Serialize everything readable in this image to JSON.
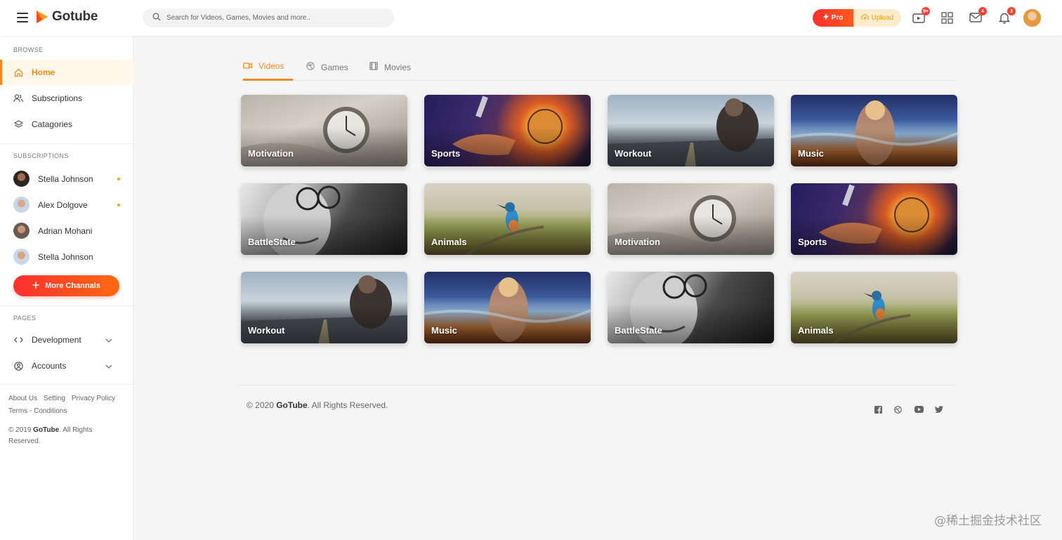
{
  "app": {
    "name": "Gotube",
    "brand_color": "#f3891c",
    "accent_red": "#ff3a2a"
  },
  "header": {
    "search_placeholder": "Search for Videos, Games, Movies and more..",
    "pro_label": "Pro",
    "upload_label": "Upload",
    "icons": [
      {
        "name": "video-icon",
        "badge": "9+"
      },
      {
        "name": "grid-icon",
        "badge": ""
      },
      {
        "name": "mail-icon",
        "badge": "4"
      },
      {
        "name": "bell-icon",
        "badge": "3"
      }
    ]
  },
  "sidebar": {
    "browse_title": "BROWSE",
    "browse": [
      {
        "label": "Home",
        "icon": "home-icon",
        "active": true
      },
      {
        "label": "Subscriptions",
        "icon": "users-icon"
      },
      {
        "label": "Catagories",
        "icon": "layers-icon"
      }
    ],
    "subscriptions_title": "SUBSCRIPTIONS",
    "subscriptions": [
      {
        "name": "Stella Johnson",
        "dot": true
      },
      {
        "name": "Alex Dolgove",
        "dot": true
      },
      {
        "name": "Adrian Mohani",
        "dot": false
      },
      {
        "name": "Stella Johnson",
        "dot": false
      }
    ],
    "more_label": "More Channals",
    "pages_title": "PAGES",
    "pages": [
      {
        "label": "Development",
        "icon": "code-icon"
      },
      {
        "label": "Accounts",
        "icon": "user-circle-icon"
      }
    ],
    "links": [
      "About Us",
      "Setting",
      "Privacy Policy",
      "Terms - Conditions"
    ],
    "copyright_prefix": "© 2019 ",
    "copyright_brand": "GoTube",
    "copyright_suffix": ". All Rights Reserved."
  },
  "main": {
    "tabs": [
      {
        "label": "Videos",
        "icon": "video-camera-icon",
        "active": true
      },
      {
        "label": "Games",
        "icon": "dribbble-icon"
      },
      {
        "label": "Movies",
        "icon": "film-icon"
      }
    ],
    "cards": [
      {
        "label": "Motivation",
        "art": "motivation"
      },
      {
        "label": "Sports",
        "art": "sports"
      },
      {
        "label": "Workout",
        "art": "workout"
      },
      {
        "label": "Music",
        "art": "music"
      },
      {
        "label": "BattleState",
        "art": "battle"
      },
      {
        "label": "Animals",
        "art": "animals"
      },
      {
        "label": "Motivation",
        "art": "motivation"
      },
      {
        "label": "Sports",
        "art": "sports"
      },
      {
        "label": "Workout",
        "art": "workout"
      },
      {
        "label": "Music",
        "art": "music"
      },
      {
        "label": "BattleState",
        "art": "battle"
      },
      {
        "label": "Animals",
        "art": "animals"
      }
    ],
    "footer": {
      "prefix": "© 2020 ",
      "brand": "GoTube",
      "suffix": ". All Rights Reserved.",
      "social": [
        "facebook-icon",
        "dribbble-icon",
        "youtube-icon",
        "twitter-icon"
      ]
    }
  },
  "watermark": "@稀土掘金技术社区"
}
